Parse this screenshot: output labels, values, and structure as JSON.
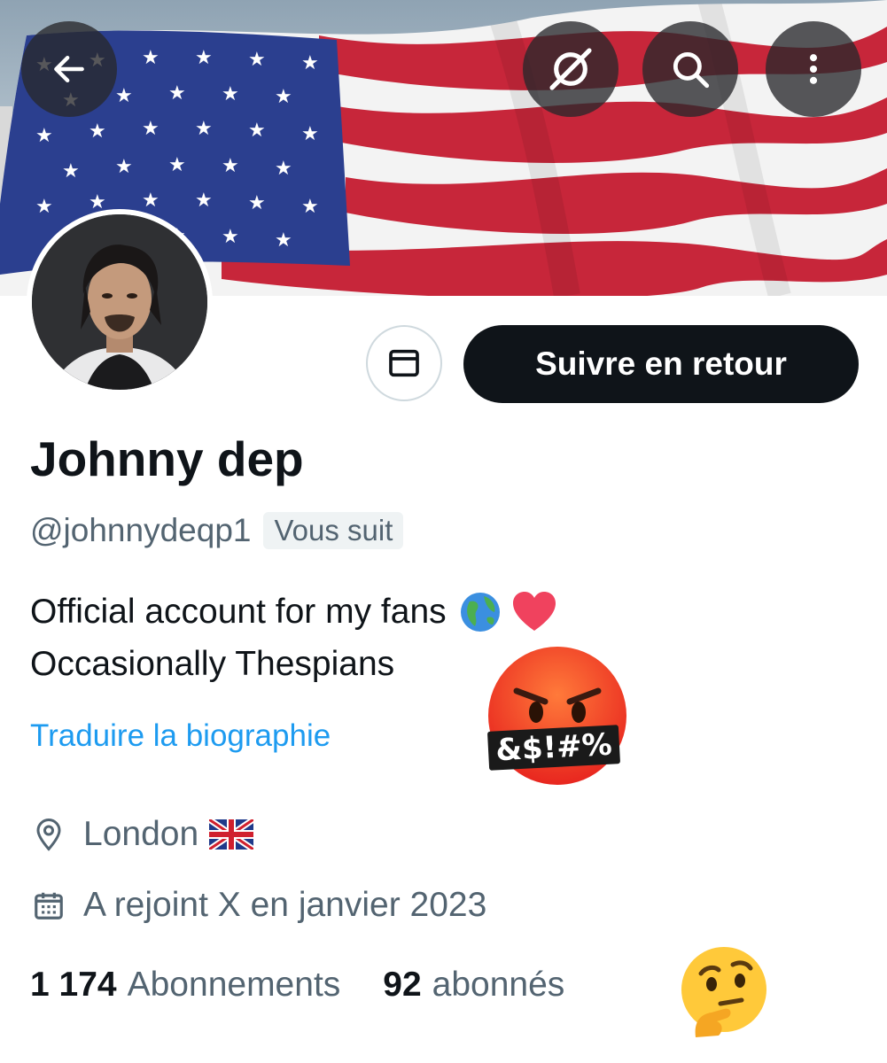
{
  "header": {
    "back_icon": "arrow-left-icon",
    "grok_icon": "grok-icon",
    "search_icon": "search-icon",
    "more_icon": "more-vertical-icon"
  },
  "profile": {
    "name": "Johnny dep",
    "handle": "@johnnydeqp1",
    "follows_you": "Vous suit",
    "bio_line1": "Official account for my fans",
    "bio_line2": "Occasionally Thespians",
    "translate": "Traduire la biographie",
    "location": "London",
    "joined": "A rejoint X en janvier 2023",
    "following_count": "1 174",
    "following_label": "Abonnements",
    "followers_count": "92",
    "followers_label": "abonnés"
  },
  "actions": {
    "follow_back": "Suivre en retour",
    "message_icon": "envelope-icon"
  },
  "overlay": {
    "cursing_text": "&$!#%"
  },
  "colors": {
    "primary_text": "#0f1419",
    "secondary_text": "#536471",
    "link": "#1d9bf0",
    "button_bg": "#0f1419",
    "flag_red": "#c7263a",
    "flag_blue": "#2b3f8f"
  }
}
